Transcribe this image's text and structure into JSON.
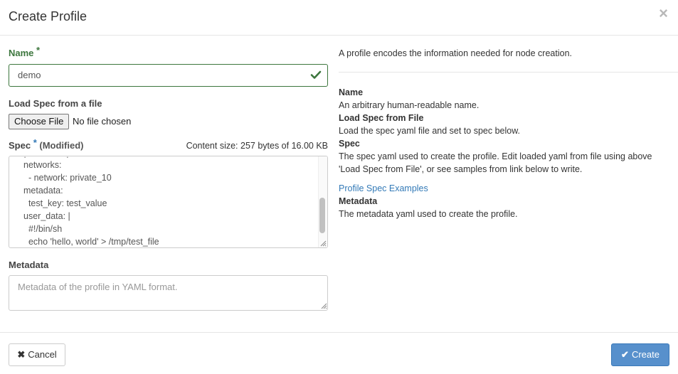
{
  "dialog": {
    "title": "Create Profile",
    "close_icon": "×"
  },
  "form": {
    "name": {
      "label": "Name",
      "required_mark": "*",
      "value": "demo"
    },
    "load_spec": {
      "label": "Load Spec from a file",
      "button_label": "Choose File",
      "status": "No file chosen"
    },
    "spec": {
      "label": "Spec",
      "required_mark": "*",
      "modified": "(Modified)",
      "content_size": "Content size: 257 bytes of 16.00 KB",
      "lines": [
        "networks:",
        "  - network: private_10",
        "metadata:",
        "  test_key: test_value",
        "user_data: |",
        "  #!/bin/sh",
        "  echo 'hello, world' > /tmp/test_file"
      ]
    },
    "metadata": {
      "label": "Metadata",
      "placeholder": "Metadata of the profile in YAML format."
    }
  },
  "help": {
    "intro": "A profile encodes the information needed for node creation.",
    "name_title": "Name",
    "name_desc": "An arbitrary human-readable name.",
    "load_title": "Load Spec from File",
    "load_desc": "Load the spec yaml file and set to spec below.",
    "spec_title": "Spec",
    "spec_desc": "The spec yaml used to create the profile. Edit loaded yaml from file using above 'Load Spec from File', or see samples from link below to write.",
    "link": "Profile Spec Examples",
    "metadata_title": "Metadata",
    "metadata_desc": "The metadata yaml used to create the profile."
  },
  "footer": {
    "cancel_label": "Cancel",
    "create_label": "Create",
    "cancel_icon": "✖",
    "create_icon": "✔"
  },
  "colors": {
    "success": "#3c763d",
    "primary": "#5790cc",
    "link": "#337ab7"
  }
}
